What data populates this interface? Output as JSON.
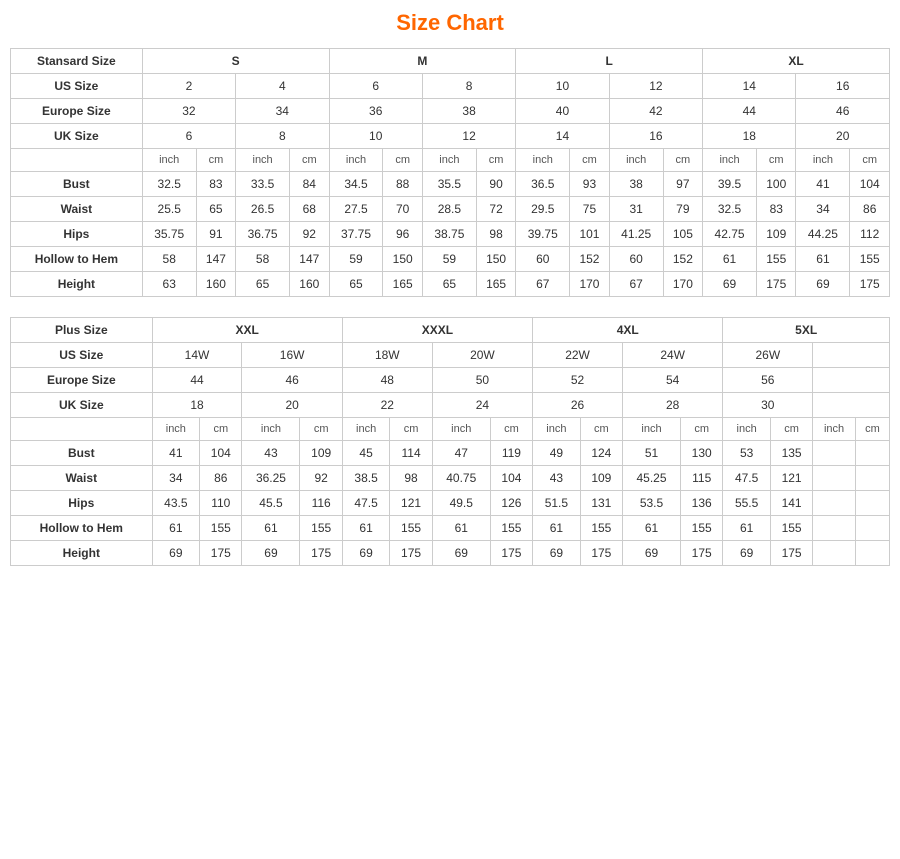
{
  "title": "Size Chart",
  "standard": {
    "table_label": "Stansard Size",
    "size_groups": [
      "S",
      "M",
      "L",
      "XL"
    ],
    "us_sizes": [
      "2",
      "4",
      "6",
      "8",
      "10",
      "12",
      "14",
      "16"
    ],
    "europe_sizes": [
      "32",
      "34",
      "36",
      "38",
      "40",
      "42",
      "44",
      "46"
    ],
    "uk_sizes": [
      "6",
      "8",
      "10",
      "12",
      "14",
      "16",
      "18",
      "20"
    ],
    "measurements": {
      "bust": [
        "32.5",
        "83",
        "33.5",
        "84",
        "34.5",
        "88",
        "35.5",
        "90",
        "36.5",
        "93",
        "38",
        "97",
        "39.5",
        "100",
        "41",
        "104"
      ],
      "waist": [
        "25.5",
        "65",
        "26.5",
        "68",
        "27.5",
        "70",
        "28.5",
        "72",
        "29.5",
        "75",
        "31",
        "79",
        "32.5",
        "83",
        "34",
        "86"
      ],
      "hips": [
        "35.75",
        "91",
        "36.75",
        "92",
        "37.75",
        "96",
        "38.75",
        "98",
        "39.75",
        "101",
        "41.25",
        "105",
        "42.75",
        "109",
        "44.25",
        "112"
      ],
      "hollow": [
        "58",
        "147",
        "58",
        "147",
        "59",
        "150",
        "59",
        "150",
        "60",
        "152",
        "60",
        "152",
        "61",
        "155",
        "61",
        "155"
      ],
      "height": [
        "63",
        "160",
        "65",
        "160",
        "65",
        "165",
        "65",
        "165",
        "67",
        "170",
        "67",
        "170",
        "69",
        "175",
        "69",
        "175"
      ]
    }
  },
  "plus": {
    "table_label": "Plus Size",
    "size_groups": [
      "XXL",
      "XXXL",
      "4XL",
      "5XL"
    ],
    "us_sizes": [
      "14W",
      "16W",
      "18W",
      "20W",
      "22W",
      "24W",
      "26W"
    ],
    "europe_sizes": [
      "44",
      "46",
      "48",
      "50",
      "52",
      "54",
      "56"
    ],
    "uk_sizes": [
      "18",
      "20",
      "22",
      "24",
      "26",
      "28",
      "30"
    ],
    "measurements": {
      "bust": [
        "41",
        "104",
        "43",
        "109",
        "45",
        "114",
        "47",
        "119",
        "49",
        "124",
        "51",
        "130",
        "53",
        "135"
      ],
      "waist": [
        "34",
        "86",
        "36.25",
        "92",
        "38.5",
        "98",
        "40.75",
        "104",
        "43",
        "109",
        "45.25",
        "115",
        "47.5",
        "121"
      ],
      "hips": [
        "43.5",
        "110",
        "45.5",
        "116",
        "47.5",
        "121",
        "49.5",
        "126",
        "51.5",
        "131",
        "53.5",
        "136",
        "55.5",
        "141"
      ],
      "hollow": [
        "61",
        "155",
        "61",
        "155",
        "61",
        "155",
        "61",
        "155",
        "61",
        "155",
        "61",
        "155",
        "61",
        "155"
      ],
      "height": [
        "69",
        "175",
        "69",
        "175",
        "69",
        "175",
        "69",
        "175",
        "69",
        "175",
        "69",
        "175",
        "69",
        "175"
      ]
    }
  },
  "labels": {
    "us_size": "US Size",
    "europe_size": "Europe Size",
    "uk_size": "UK Size",
    "inch": "inch",
    "cm": "cm",
    "bust": "Bust",
    "waist": "Waist",
    "hips": "Hips",
    "hollow": "Hollow to Hem",
    "height": "Height"
  }
}
